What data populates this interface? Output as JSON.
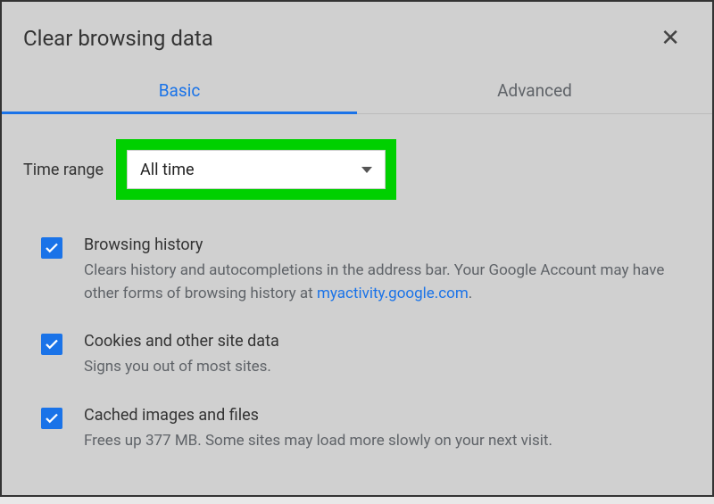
{
  "dialog": {
    "title": "Clear browsing data"
  },
  "tabs": {
    "basic": "Basic",
    "advanced": "Advanced"
  },
  "time_range": {
    "label": "Time range",
    "selected": "All time"
  },
  "options": {
    "browsing_history": {
      "title": "Browsing history",
      "desc_before": "Clears history and autocompletions in the address bar. Your Google Account may have other forms of browsing history at ",
      "link_text": "myactivity.google.com",
      "desc_after": "."
    },
    "cookies": {
      "title": "Cookies and other site data",
      "desc": "Signs you out of most sites."
    },
    "cache": {
      "title": "Cached images and files",
      "desc": "Frees up 377 MB. Some sites may load more slowly on your next visit."
    }
  }
}
